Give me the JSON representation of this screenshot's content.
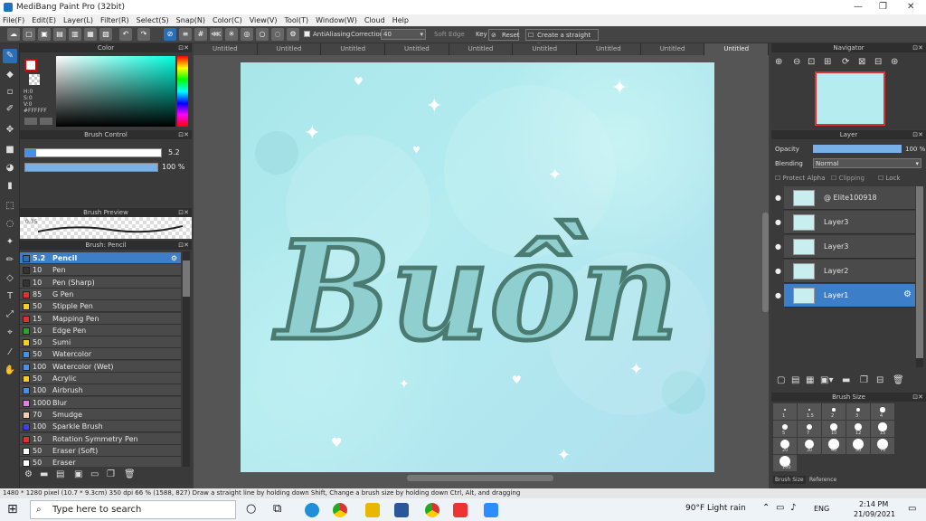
{
  "title": "MediBang Paint Pro (32bit)",
  "menu": [
    "File(F)",
    "Edit(E)",
    "Layer(L)",
    "Filter(R)",
    "Select(S)",
    "Snap(N)",
    "Color(C)",
    "View(V)",
    "Tool(T)",
    "Window(W)",
    "Cloud",
    "Help"
  ],
  "toolbar": {
    "antialiasing": "AntiAliasing",
    "correction_label": "Correction",
    "correction_value": "40",
    "soft_edge": "Soft Edge",
    "key": "Key",
    "reset": "Reset",
    "straight_line": "Create a straight line"
  },
  "tabs": [
    "Untitled",
    "Untitled",
    "Untitled",
    "Untitled",
    "Untitled",
    "Untitled",
    "Untitled",
    "Untitled",
    "Untitled"
  ],
  "color_panel": {
    "title": "Color",
    "h": "H:0",
    "s": "S:0",
    "v": "V:0",
    "hex": "#FFFFFF"
  },
  "brush_control": {
    "title": "Brush Control",
    "size": "5.2",
    "opacity": "100 %"
  },
  "brush_preview": {
    "title": "Brush Preview",
    "size_label": "0.35"
  },
  "brush_list": {
    "title": "Brush: Pencil",
    "items": [
      {
        "size": "5.2",
        "name": "Pencil",
        "color": "#2c6eb5"
      },
      {
        "size": "10",
        "name": "Pen",
        "color": "#333333"
      },
      {
        "size": "10",
        "name": "Pen (Sharp)",
        "color": "#333333"
      },
      {
        "size": "85",
        "name": "G Pen",
        "color": "#e03030"
      },
      {
        "size": "50",
        "name": "Stipple Pen",
        "color": "#f0d020"
      },
      {
        "size": "15",
        "name": "Mapping Pen",
        "color": "#e03030"
      },
      {
        "size": "10",
        "name": "Edge Pen",
        "color": "#30a030"
      },
      {
        "size": "50",
        "name": "Sumi",
        "color": "#f0d020"
      },
      {
        "size": "50",
        "name": "Watercolor",
        "color": "#4a90e0"
      },
      {
        "size": "100",
        "name": "Watercolor (Wet)",
        "color": "#4a90e0"
      },
      {
        "size": "50",
        "name": "Acrylic",
        "color": "#f0d020"
      },
      {
        "size": "100",
        "name": "Airbrush",
        "color": "#4a90e0"
      },
      {
        "size": "1000",
        "name": "Blur",
        "color": "#e080e0"
      },
      {
        "size": "70",
        "name": "Smudge",
        "color": "#f0d0b0"
      },
      {
        "size": "100",
        "name": "Sparkle Brush",
        "color": "#4040e0"
      },
      {
        "size": "10",
        "name": "Rotation Symmetry Pen",
        "color": "#e03030"
      },
      {
        "size": "50",
        "name": "Eraser (Soft)",
        "color": "#ffffff"
      },
      {
        "size": "50",
        "name": "Eraser",
        "color": "#ffffff"
      }
    ]
  },
  "canvas_text": "Buồn",
  "navigator": {
    "title": "Navigator"
  },
  "layer_panel": {
    "title": "Layer",
    "opacity_label": "Opacity",
    "opacity_value": "100 %",
    "blending_label": "Blending",
    "blending_value": "Normal",
    "protect_alpha": "Protect Alpha",
    "clipping": "Clipping",
    "lock": "Lock",
    "layers": [
      "@ Elite100918",
      "Layer3",
      "Layer3",
      "Layer2",
      "Layer1"
    ]
  },
  "brush_size_panel": {
    "title": "Brush Size",
    "labels": [
      "1",
      "1.5",
      "2",
      "3",
      "4",
      "5",
      "7",
      "10",
      "12",
      "15",
      "20",
      "30",
      "40",
      "50",
      "70",
      "100"
    ],
    "tab1": "Brush Size",
    "tab2": "Reference"
  },
  "status": "1480 * 1280 pixel  (10.7 * 9.3cm)  350 dpi  66 %  (1588, 827)  Draw a straight line by holding down Shift, Change a brush size by holding down Ctrl, Alt, and dragging",
  "taskbar": {
    "search": "Type here to search",
    "weather": "90°F  Light rain",
    "lang": "ENG",
    "time": "2:14 PM",
    "date": "21/09/2021"
  }
}
